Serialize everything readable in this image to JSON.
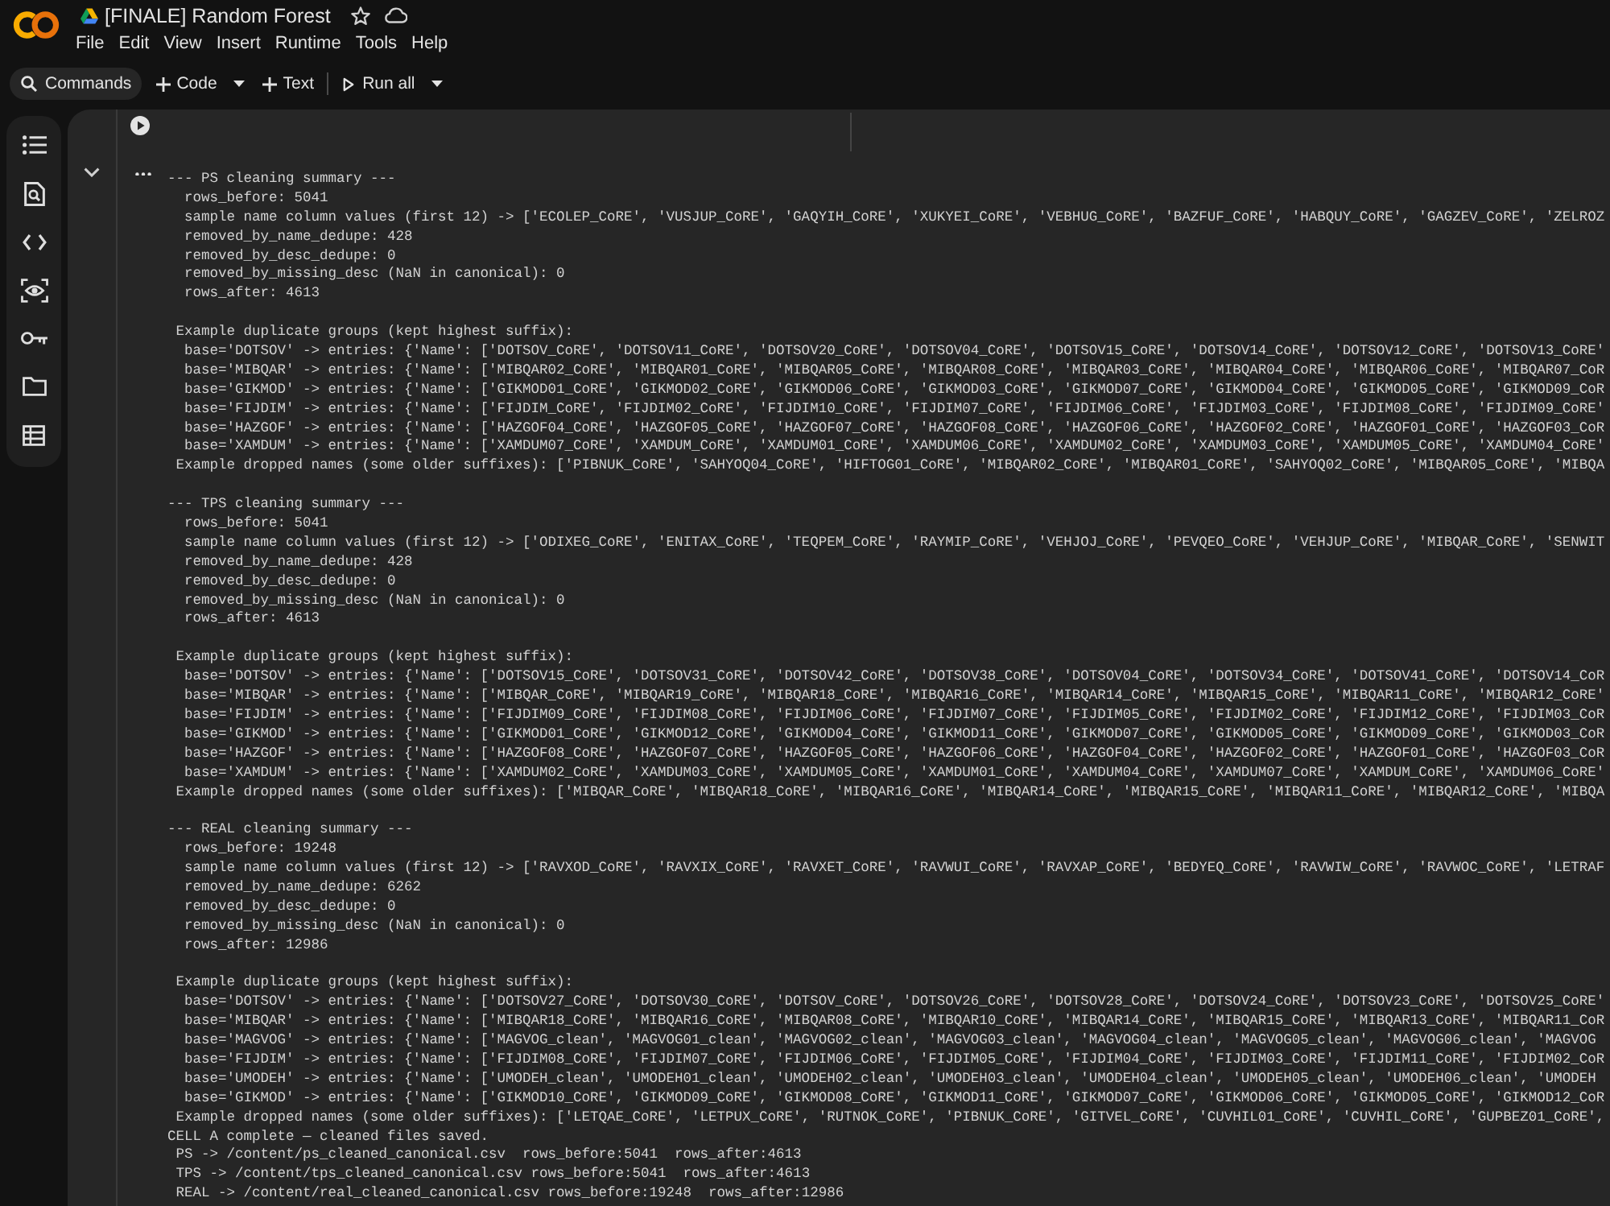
{
  "window": {
    "title": "[FINALE] Random Forest"
  },
  "menu": [
    "File",
    "Edit",
    "View",
    "Insert",
    "Runtime",
    "Tools",
    "Help"
  ],
  "toolbar": [
    {
      "kind": "search",
      "label": "Commands",
      "dropdown": false
    },
    {
      "kind": "add",
      "label": "Code",
      "dropdown": true
    },
    {
      "kind": "add",
      "label": "Text",
      "dropdown": false
    },
    {
      "kind": "run",
      "label": "Run all",
      "dropdown": true
    }
  ],
  "output": {
    "expanded": true,
    "blocks": [
      {
        "lines": [
          {
            "kind": "heading",
            "text": "--- PS cleaning summary ---"
          },
          {
            "kind": "detail",
            "text": "rows_before: 5041"
          },
          {
            "kind": "detail",
            "text": "sample name column values (first 12) -> ['ECOLEP_CoRE', 'VUSJUP_CoRE', 'GAQYIH_CoRE', 'XUKYEI_CoRE', 'VEBHUG_CoRE', 'BAZFUF_CoRE', 'HABQUY_CoRE', 'GAGZEV_CoRE', 'ZELROZ"
          },
          {
            "kind": "detail",
            "text": "removed_by_name_dedupe: 428"
          },
          {
            "kind": "detail",
            "text": "removed_by_desc_dedupe: 0"
          },
          {
            "kind": "detail",
            "text": "removed_by_missing_desc (NaN in canonical): 0"
          },
          {
            "kind": "detail",
            "text": "rows_after: 4613"
          }
        ]
      },
      {
        "lines": [
          {
            "kind": "note",
            "text": "Example duplicate groups (kept highest suffix):"
          },
          {
            "kind": "detail",
            "text": "base='DOTSOV' -> entries: {'Name': ['DOTSOV_CoRE', 'DOTSOV11_CoRE', 'DOTSOV20_CoRE', 'DOTSOV04_CoRE', 'DOTSOV15_CoRE', 'DOTSOV14_CoRE', 'DOTSOV12_CoRE', 'DOTSOV13_CoRE'"
          },
          {
            "kind": "detail",
            "text": "base='MIBQAR' -> entries: {'Name': ['MIBQAR02_CoRE', 'MIBQAR01_CoRE', 'MIBQAR05_CoRE', 'MIBQAR08_CoRE', 'MIBQAR03_CoRE', 'MIBQAR04_CoRE', 'MIBQAR06_CoRE', 'MIBQAR07_CoR"
          },
          {
            "kind": "detail",
            "text": "base='GIKMOD' -> entries: {'Name': ['GIKMOD01_CoRE', 'GIKMOD02_CoRE', 'GIKMOD06_CoRE', 'GIKMOD03_CoRE', 'GIKMOD07_CoRE', 'GIKMOD04_CoRE', 'GIKMOD05_CoRE', 'GIKMOD09_CoR"
          },
          {
            "kind": "detail",
            "text": "base='FIJDIM' -> entries: {'Name': ['FIJDIM_CoRE', 'FIJDIM02_CoRE', 'FIJDIM10_CoRE', 'FIJDIM07_CoRE', 'FIJDIM06_CoRE', 'FIJDIM03_CoRE', 'FIJDIM08_CoRE', 'FIJDIM09_CoRE'"
          },
          {
            "kind": "detail",
            "text": "base='HAZGOF' -> entries: {'Name': ['HAZGOF04_CoRE', 'HAZGOF05_CoRE', 'HAZGOF07_CoRE', 'HAZGOF08_CoRE', 'HAZGOF06_CoRE', 'HAZGOF02_CoRE', 'HAZGOF01_CoRE', 'HAZGOF03_CoR"
          },
          {
            "kind": "detail",
            "text": "base='XAMDUM' -> entries: {'Name': ['XAMDUM07_CoRE', 'XAMDUM_CoRE', 'XAMDUM01_CoRE', 'XAMDUM06_CoRE', 'XAMDUM02_CoRE', 'XAMDUM03_CoRE', 'XAMDUM05_CoRE', 'XAMDUM04_CoRE'"
          },
          {
            "kind": "note",
            "text": "Example dropped names (some older suffixes): ['PIBNUK_CoRE', 'SAHYOQ04_CoRE', 'HIFTOG01_CoRE', 'MIBQAR02_CoRE', 'MIBQAR01_CoRE', 'SAHYOQ02_CoRE', 'MIBQAR05_CoRE', 'MIBQA"
          }
        ]
      },
      {
        "lines": [
          {
            "kind": "heading",
            "text": "--- TPS cleaning summary ---"
          },
          {
            "kind": "detail",
            "text": "rows_before: 5041"
          },
          {
            "kind": "detail",
            "text": "sample name column values (first 12) -> ['ODIXEG_CoRE', 'ENITAX_CoRE', 'TEQPEM_CoRE', 'RAYMIP_CoRE', 'VEHJOJ_CoRE', 'PEVQEO_CoRE', 'VEHJUP_CoRE', 'MIBQAR_CoRE', 'SENWIT"
          },
          {
            "kind": "detail",
            "text": "removed_by_name_dedupe: 428"
          },
          {
            "kind": "detail",
            "text": "removed_by_desc_dedupe: 0"
          },
          {
            "kind": "detail",
            "text": "removed_by_missing_desc (NaN in canonical): 0"
          },
          {
            "kind": "detail",
            "text": "rows_after: 4613"
          }
        ]
      },
      {
        "lines": [
          {
            "kind": "note",
            "text": "Example duplicate groups (kept highest suffix):"
          },
          {
            "kind": "detail",
            "text": "base='DOTSOV' -> entries: {'Name': ['DOTSOV15_CoRE', 'DOTSOV31_CoRE', 'DOTSOV42_CoRE', 'DOTSOV38_CoRE', 'DOTSOV04_CoRE', 'DOTSOV34_CoRE', 'DOTSOV41_CoRE', 'DOTSOV14_CoR"
          },
          {
            "kind": "detail",
            "text": "base='MIBQAR' -> entries: {'Name': ['MIBQAR_CoRE', 'MIBQAR19_CoRE', 'MIBQAR18_CoRE', 'MIBQAR16_CoRE', 'MIBQAR14_CoRE', 'MIBQAR15_CoRE', 'MIBQAR11_CoRE', 'MIBQAR12_CoRE'"
          },
          {
            "kind": "detail",
            "text": "base='FIJDIM' -> entries: {'Name': ['FIJDIM09_CoRE', 'FIJDIM08_CoRE', 'FIJDIM06_CoRE', 'FIJDIM07_CoRE', 'FIJDIM05_CoRE', 'FIJDIM02_CoRE', 'FIJDIM12_CoRE', 'FIJDIM03_CoR"
          },
          {
            "kind": "detail",
            "text": "base='GIKMOD' -> entries: {'Name': ['GIKMOD01_CoRE', 'GIKMOD12_CoRE', 'GIKMOD04_CoRE', 'GIKMOD11_CoRE', 'GIKMOD07_CoRE', 'GIKMOD05_CoRE', 'GIKMOD09_CoRE', 'GIKMOD03_CoR"
          },
          {
            "kind": "detail",
            "text": "base='HAZGOF' -> entries: {'Name': ['HAZGOF08_CoRE', 'HAZGOF07_CoRE', 'HAZGOF05_CoRE', 'HAZGOF06_CoRE', 'HAZGOF04_CoRE', 'HAZGOF02_CoRE', 'HAZGOF01_CoRE', 'HAZGOF03_CoR"
          },
          {
            "kind": "detail",
            "text": "base='XAMDUM' -> entries: {'Name': ['XAMDUM02_CoRE', 'XAMDUM03_CoRE', 'XAMDUM05_CoRE', 'XAMDUM01_CoRE', 'XAMDUM04_CoRE', 'XAMDUM07_CoRE', 'XAMDUM_CoRE', 'XAMDUM06_CoRE'"
          },
          {
            "kind": "note",
            "text": "Example dropped names (some older suffixes): ['MIBQAR_CoRE', 'MIBQAR18_CoRE', 'MIBQAR16_CoRE', 'MIBQAR14_CoRE', 'MIBQAR15_CoRE', 'MIBQAR11_CoRE', 'MIBQAR12_CoRE', 'MIBQA"
          }
        ]
      },
      {
        "lines": [
          {
            "kind": "heading",
            "text": "--- REAL cleaning summary ---"
          },
          {
            "kind": "detail",
            "text": "rows_before: 19248"
          },
          {
            "kind": "detail",
            "text": "sample name column values (first 12) -> ['RAVXOD_CoRE', 'RAVXIX_CoRE', 'RAVXET_CoRE', 'RAVWUI_CoRE', 'RAVXAP_CoRE', 'BEDYEQ_CoRE', 'RAVWIW_CoRE', 'RAVWOC_CoRE', 'LETRAF"
          },
          {
            "kind": "detail",
            "text": "removed_by_name_dedupe: 6262"
          },
          {
            "kind": "detail",
            "text": "removed_by_desc_dedupe: 0"
          },
          {
            "kind": "detail",
            "text": "removed_by_missing_desc (NaN in canonical): 0"
          },
          {
            "kind": "detail",
            "text": "rows_after: 12986"
          }
        ]
      },
      {
        "lines": [
          {
            "kind": "note",
            "text": "Example duplicate groups (kept highest suffix):"
          },
          {
            "kind": "detail",
            "text": "base='DOTSOV' -> entries: {'Name': ['DOTSOV27_CoRE', 'DOTSOV30_CoRE', 'DOTSOV_CoRE', 'DOTSOV26_CoRE', 'DOTSOV28_CoRE', 'DOTSOV24_CoRE', 'DOTSOV23_CoRE', 'DOTSOV25_CoRE'"
          },
          {
            "kind": "detail",
            "text": "base='MIBQAR' -> entries: {'Name': ['MIBQAR18_CoRE', 'MIBQAR16_CoRE', 'MIBQAR08_CoRE', 'MIBQAR10_CoRE', 'MIBQAR14_CoRE', 'MIBQAR15_CoRE', 'MIBQAR13_CoRE', 'MIBQAR11_CoR"
          },
          {
            "kind": "detail",
            "text": "base='MAGVOG' -> entries: {'Name': ['MAGVOG_clean', 'MAGVOG01_clean', 'MAGVOG02_clean', 'MAGVOG03_clean', 'MAGVOG04_clean', 'MAGVOG05_clean', 'MAGVOG06_clean', 'MAGVOG"
          },
          {
            "kind": "detail",
            "text": "base='FIJDIM' -> entries: {'Name': ['FIJDIM08_CoRE', 'FIJDIM07_CoRE', 'FIJDIM06_CoRE', 'FIJDIM05_CoRE', 'FIJDIM04_CoRE', 'FIJDIM03_CoRE', 'FIJDIM11_CoRE', 'FIJDIM02_CoR"
          },
          {
            "kind": "detail",
            "text": "base='UMODEH' -> entries: {'Name': ['UMODEH_clean', 'UMODEH01_clean', 'UMODEH02_clean', 'UMODEH03_clean', 'UMODEH04_clean', 'UMODEH05_clean', 'UMODEH06_clean', 'UMODEH"
          },
          {
            "kind": "detail",
            "text": "base='GIKMOD' -> entries: {'Name': ['GIKMOD10_CoRE', 'GIKMOD09_CoRE', 'GIKMOD08_CoRE', 'GIKMOD11_CoRE', 'GIKMOD07_CoRE', 'GIKMOD06_CoRE', 'GIKMOD05_CoRE', 'GIKMOD12_CoR"
          },
          {
            "kind": "note",
            "text": "Example dropped names (some older suffixes): ['LETQAE_CoRE', 'LETPUX_CoRE', 'RUTNOK_CoRE', 'PIBNUK_CoRE', 'GITVEL_CoRE', 'CUVHIL01_CoRE', 'CUVHIL_CoRE', 'GUPBEZ01_CoRE',"
          },
          {
            "kind": "heading",
            "text": "CELL A complete — cleaned files saved."
          },
          {
            "kind": "note",
            "text": "PS -> /content/ps_cleaned_canonical.csv  rows_before:5041  rows_after:4613"
          },
          {
            "kind": "note",
            "text": "TPS -> /content/tps_cleaned_canonical.csv rows_before:5041  rows_after:4613"
          },
          {
            "kind": "note",
            "text": "REAL -> /content/real_cleaned_canonical.csv rows_before:19248  rows_after:12986"
          }
        ]
      }
    ]
  }
}
